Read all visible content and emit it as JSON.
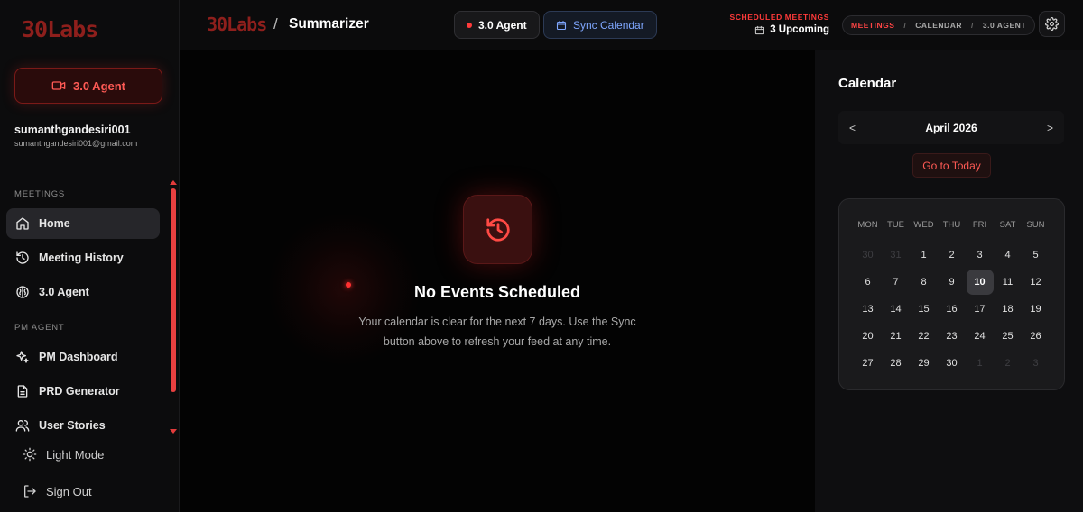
{
  "sidebar": {
    "logo": "30Labs",
    "agent_button": "3.0 Agent",
    "user": {
      "name": "sumanthgandesiri001",
      "email": "sumanthgandesiri001@gmail.com"
    },
    "meetings_label": "MEETINGS",
    "meetings_items": [
      {
        "label": "Home",
        "icon": "home-icon",
        "active": true
      },
      {
        "label": "Meeting History",
        "icon": "history-icon"
      },
      {
        "label": "3.0 Agent",
        "icon": "brain-icon"
      }
    ],
    "pm_label": "PM AGENT",
    "pm_items": [
      {
        "label": "PM Dashboard",
        "icon": "sparkles-icon"
      },
      {
        "label": "PRD Generator",
        "icon": "document-icon"
      },
      {
        "label": "User Stories",
        "icon": "users-icon"
      }
    ],
    "light_mode": "Light Mode",
    "sign_out": "Sign Out"
  },
  "header": {
    "logo": "30Labs",
    "separator": "/",
    "title": "Summarizer",
    "agent_pill": "3.0 Agent",
    "sync_pill": "Sync Calendar",
    "scheduled_label": "SCHEDULED MEETINGS",
    "scheduled_count": "3 Upcoming",
    "breadcrumbs": [
      "MEETINGS",
      "CALENDAR",
      "3.0 AGENT"
    ],
    "crumb_sep": "/"
  },
  "main": {
    "empty_title": "No Events Scheduled",
    "empty_desc": "Your calendar is clear for the next 7 days. Use the Sync button above to refresh your feed at any time."
  },
  "calendar": {
    "title": "Calendar",
    "prev": "<",
    "next": ">",
    "month": "April 2026",
    "today_button": "Go to Today",
    "weekdays": [
      "MON",
      "TUE",
      "WED",
      "THU",
      "FRI",
      "SAT",
      "SUN"
    ],
    "days": [
      {
        "n": "30",
        "dim": true
      },
      {
        "n": "31",
        "dim": true
      },
      {
        "n": "1"
      },
      {
        "n": "2"
      },
      {
        "n": "3"
      },
      {
        "n": "4"
      },
      {
        "n": "5"
      },
      {
        "n": "6"
      },
      {
        "n": "7"
      },
      {
        "n": "8"
      },
      {
        "n": "9"
      },
      {
        "n": "10",
        "today": true
      },
      {
        "n": "11"
      },
      {
        "n": "12"
      },
      {
        "n": "13"
      },
      {
        "n": "14"
      },
      {
        "n": "15"
      },
      {
        "n": "16"
      },
      {
        "n": "17"
      },
      {
        "n": "18"
      },
      {
        "n": "19"
      },
      {
        "n": "20"
      },
      {
        "n": "21"
      },
      {
        "n": "22"
      },
      {
        "n": "23"
      },
      {
        "n": "24"
      },
      {
        "n": "25"
      },
      {
        "n": "26"
      },
      {
        "n": "27"
      },
      {
        "n": "28"
      },
      {
        "n": "29"
      },
      {
        "n": "30"
      },
      {
        "n": "1",
        "dim": true
      },
      {
        "n": "2",
        "dim": true
      },
      {
        "n": "3",
        "dim": true
      }
    ]
  },
  "colors": {
    "accent": "#ff3b3b",
    "logo": "#8e1f1c",
    "sync": "#7fa7ff"
  }
}
